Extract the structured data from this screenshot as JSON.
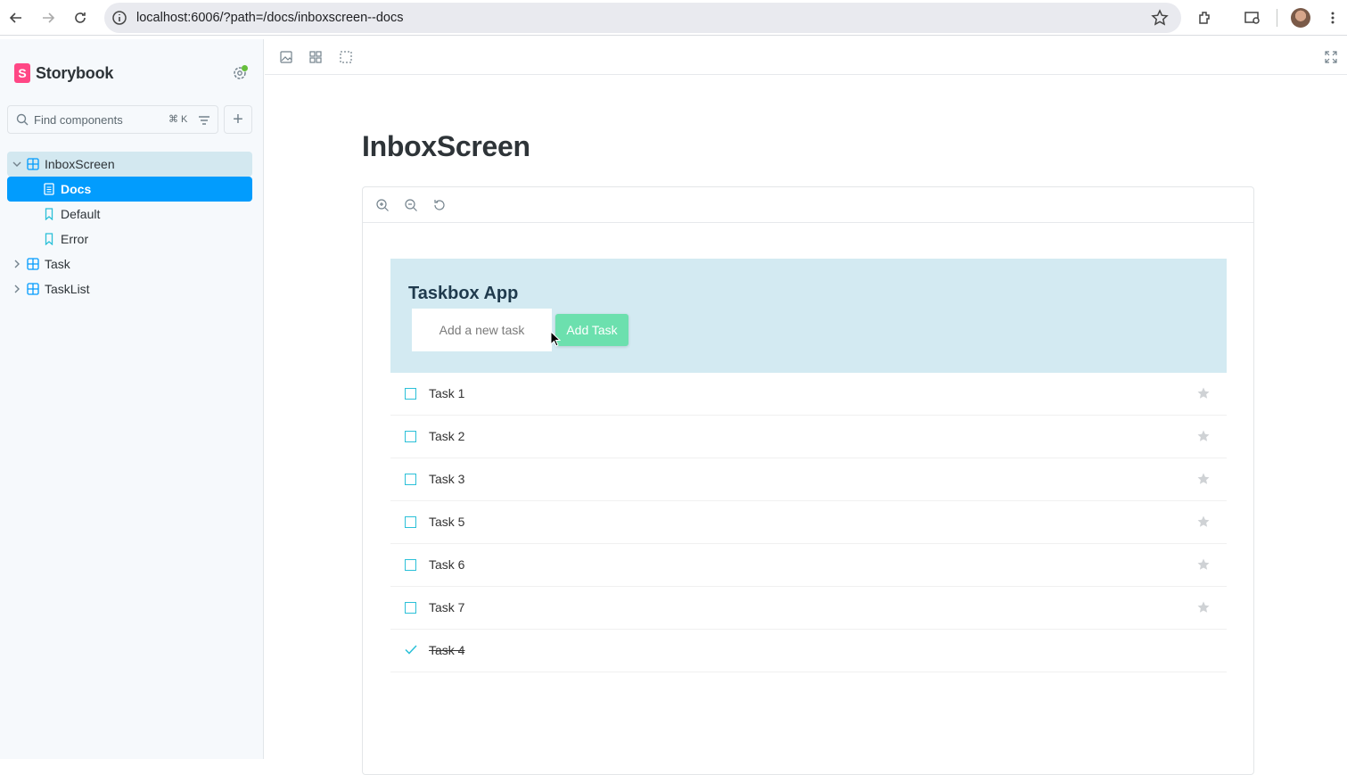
{
  "browser": {
    "url": "localhost:6006/?path=/docs/inboxscreen--docs"
  },
  "sidebar": {
    "brand": "Storybook",
    "brand_logo_letter": "S",
    "search_placeholder": "Find components",
    "search_shortcut": "⌘ K",
    "add_label": "+",
    "tree": {
      "inbox": "InboxScreen",
      "docs": "Docs",
      "default": "Default",
      "error": "Error",
      "task": "Task",
      "tasklist": "TaskList"
    }
  },
  "main": {
    "title": "InboxScreen",
    "app": {
      "title": "Taskbox App",
      "input_placeholder": "Add a new task",
      "add_button": "Add Task"
    },
    "tasks": [
      {
        "title": "Task 1",
        "done": false
      },
      {
        "title": "Task 2",
        "done": false
      },
      {
        "title": "Task 3",
        "done": false
      },
      {
        "title": "Task 5",
        "done": false
      },
      {
        "title": "Task 6",
        "done": false
      },
      {
        "title": "Task 7",
        "done": false
      },
      {
        "title": "Task 4",
        "done": true
      }
    ]
  },
  "colors": {
    "accent": "#029cfd",
    "storybook_pink": "#ff4785",
    "app_header_bg": "#d3eaf2",
    "add_button": "#6ce0ae",
    "checkbox": "#2bc0d8"
  }
}
